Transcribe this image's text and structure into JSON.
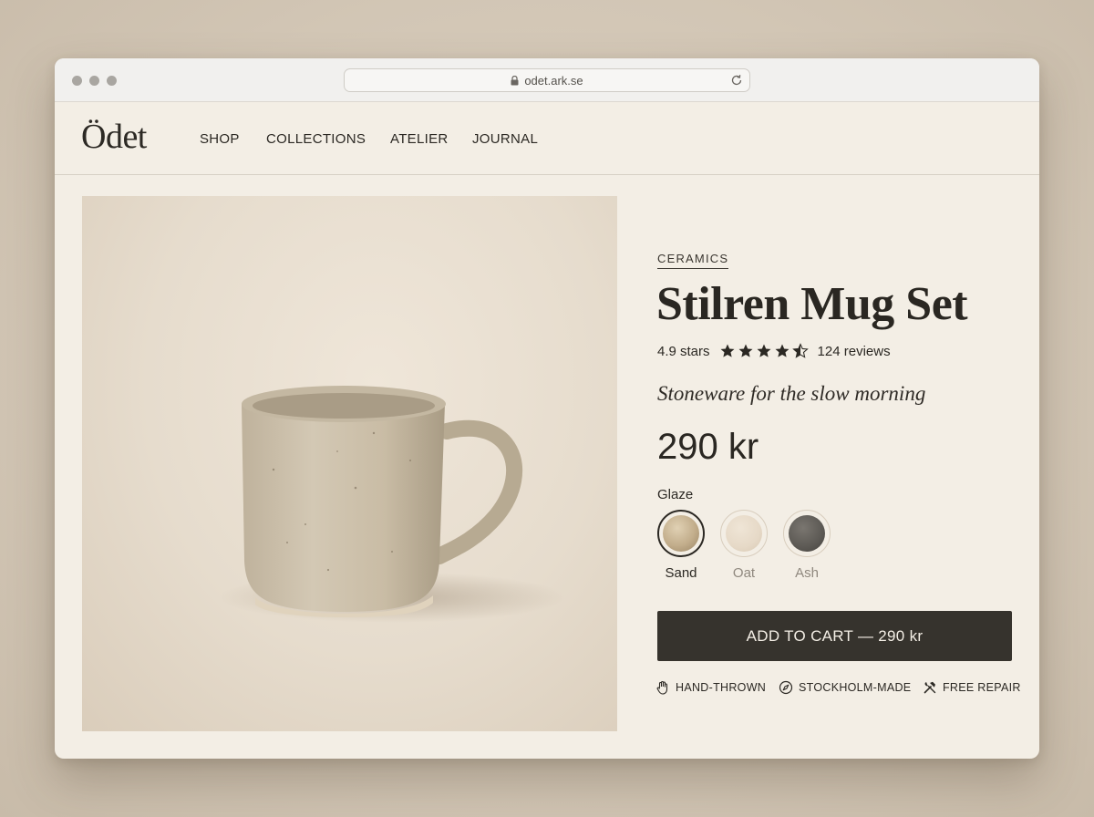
{
  "browser": {
    "url": "odet.ark.se"
  },
  "nav": {
    "logo": "Ödet",
    "items": [
      "SHOP",
      "COLLECTIONS",
      "ATELIER",
      "JOURNAL"
    ]
  },
  "product": {
    "category": "CERAMICS",
    "title": "Stilren Mug Set",
    "rating_text": "4.9 stars",
    "rating_value": 4.5,
    "reviews": "124 reviews",
    "tagline": "Stoneware for the slow morning",
    "price": "290 kr",
    "glaze_label": "Glaze",
    "glazes": [
      {
        "name": "Sand",
        "color": "#c2ad8b",
        "selected": true
      },
      {
        "name": "Oat",
        "color": "#e6d9c7",
        "selected": false
      },
      {
        "name": "Ash",
        "color": "#5c5954",
        "selected": false
      }
    ],
    "cta": "ADD TO CART — 290 kr",
    "features": [
      {
        "icon": "hand-icon",
        "label": "HAND-THROWN"
      },
      {
        "icon": "compass-icon",
        "label": "STOCKHOLM-MADE"
      },
      {
        "icon": "tools-icon",
        "label": "FREE REPAIR"
      }
    ]
  },
  "colors": {
    "accent_dark": "#36332d",
    "page_bg": "#f3eee5",
    "mug_glaze": "#cfc3ae"
  }
}
